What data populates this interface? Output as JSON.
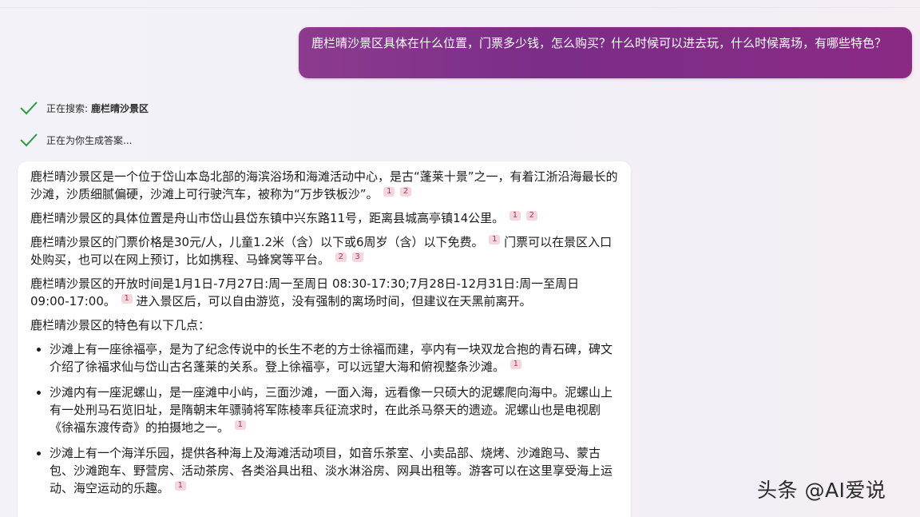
{
  "user_message": "鹿栏晴沙景区具体在什么位置，门票多少钱，怎么购买？什么时候可以进去玩，什么时候离场，有哪些特色？",
  "status": {
    "searching_prefix": "正在搜索:",
    "searching_query": "鹿栏晴沙景区",
    "generating": "正在为你生成答案..."
  },
  "answer": {
    "p1": {
      "text": "鹿栏晴沙景区是一个位于岱山本岛北部的海滨浴场和海滩活动中心，是古“蓬莱十景”之一，有着江浙沿海最长的沙滩，沙质细腻偏硬，沙滩上可行驶汽车，被称为“万步铁板沙”。",
      "c1": "1",
      "c2": "2"
    },
    "p2": {
      "text": "鹿栏晴沙景区的具体位置是舟山市岱山县岱东镇中兴东路11号，距离县城高亭镇14公里。",
      "c1": "1",
      "c2": "2"
    },
    "p3": {
      "text_a": "鹿栏晴沙景区的门票价格是30元/人，儿童1.2米（含）以下或6周岁（含）以下免费。",
      "c1": "1",
      "text_b": " 门票可以在景区入口处购买，也可以在网上预订，比如携程、马蜂窝等平台。",
      "c2": "2",
      "c3": "3"
    },
    "p4": {
      "text_a": "鹿栏晴沙景区的开放时间是1月1日-7月27日:周一至周日 08:30-17:30;7月28日-12月31日:周一至周日 09:00-17:00。",
      "c1": "1",
      "text_b": " 进入景区后，可以自由游览，没有强制的离场时间，但建议在天黑前离开。"
    },
    "p5": "鹿栏晴沙景区的特色有以下几点：",
    "bullets": [
      {
        "text": "沙滩上有一座徐福亭，是为了纪念传说中的长生不老的方士徐福而建，亭内有一块双龙合抱的青石碑，碑文介绍了徐福求仙与岱山古名蓬莱的关系。登上徐福亭，可以远望大海和俯视整条沙滩。",
        "c1": "1"
      },
      {
        "text": "沙滩内有一座泥螺山，是一座滩中小屿，三面沙滩，一面入海，远看像一只硕大的泥螺爬向海中。泥螺山上有一处刑马石览旧址，是隋朝末年骠骑将军陈棱率兵征流求时，在此杀马祭天的遗迹。泥螺山也是电视剧《徐福东渡传奇》的拍摄地之一。",
        "c1": "1"
      },
      {
        "text": "沙滩上有一个海洋乐园，提供各种海上及海滩活动项目，如音乐茶室、小卖品部、烧烤、沙滩跑马、蒙古包、沙滩跑车、野营房、活动茶房、各类浴具出租、淡水淋浴房、网具出租等。游客可以在这里享受海上运动、海空运动的乐趣。",
        "c1": "1"
      }
    ]
  },
  "watermark": "头条 @AI爱说",
  "colors": {
    "user_bubble": "#7b2d87",
    "check_green": "#2e9d3f",
    "citation_bg": "#f5d6dc"
  }
}
